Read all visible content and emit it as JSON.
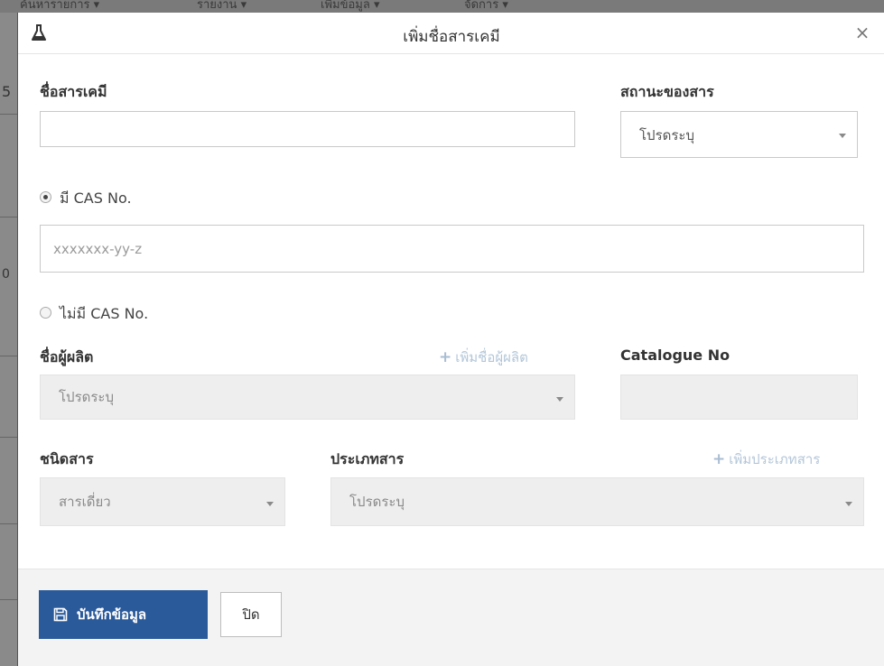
{
  "background": {
    "nav_items": [
      "ค้นหารายการ ▾",
      "รายงาน ▾",
      "เพิ่มข้อมูล ▾",
      "จัดการ ▾"
    ],
    "left_glyphs": [
      "5",
      "0"
    ]
  },
  "modal": {
    "title": "เพิ่มชื่อสารเคมี",
    "title_icon": "flask-icon",
    "close_symbol": "×"
  },
  "form": {
    "chemical_name": {
      "label": "ชื่อสารเคมี",
      "value": ""
    },
    "state": {
      "label": "สถานะของสาร",
      "selected": "โปรดระบุ"
    },
    "cas_yes": {
      "label": "มี CAS No.",
      "checked": true
    },
    "cas_input": {
      "value": "",
      "placeholder": "xxxxxxx-yy-z"
    },
    "cas_no": {
      "label": "ไม่มี CAS No.",
      "checked": false
    },
    "manufacturer": {
      "label": "ชื่อผู้ผลิต",
      "selected": "โปรดระบุ",
      "add_link": "เพิ่มชื่อผู้ผลิต"
    },
    "catalogue": {
      "label": "Catalogue No",
      "value": ""
    },
    "substance_kind": {
      "label": "ชนิดสาร",
      "selected": "สารเดี่ยว"
    },
    "substance_type": {
      "label": "ประเภทสาร",
      "selected": "โปรดระบุ",
      "add_link": "เพิ่มประเภทสาร"
    }
  },
  "footer": {
    "save_label": "บันทึกข้อมูล",
    "close_label": "ปิด"
  },
  "colors": {
    "primary": "#2b5a9a",
    "disabled_bg": "#eeeeee",
    "link_muted": "#b3c6d9"
  }
}
